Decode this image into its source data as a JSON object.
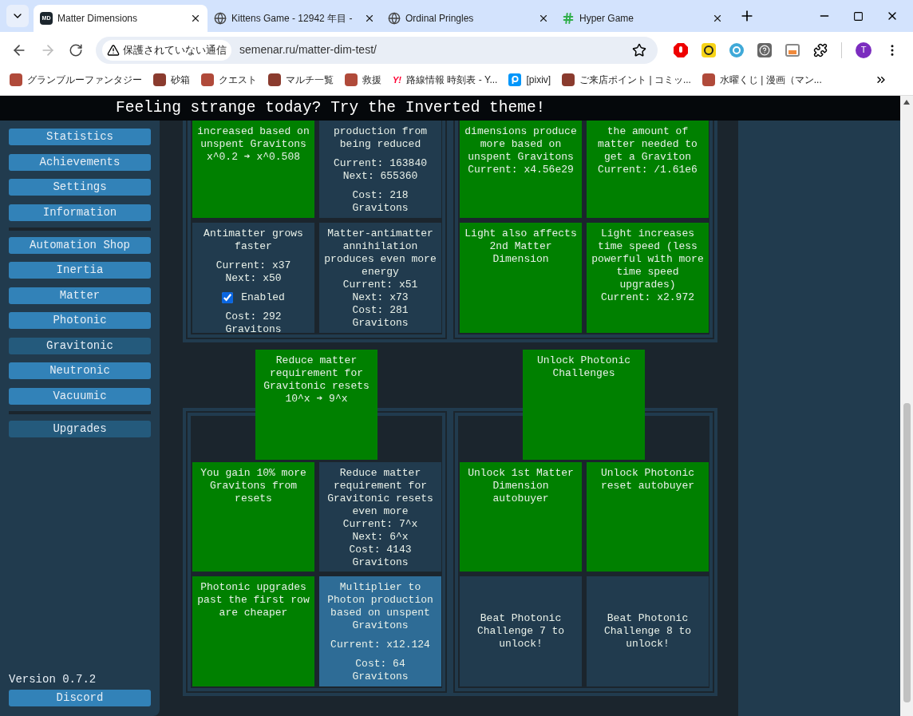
{
  "browser": {
    "tabs": [
      {
        "title": "Matter Dimensions",
        "favicon_text": "MD",
        "selected": true
      },
      {
        "title": "Kittens Game - 12942 年目 -",
        "selected": false
      },
      {
        "title": "Ordinal Pringles",
        "selected": false
      },
      {
        "title": "Hyper Game",
        "selected": false
      }
    ],
    "address": {
      "security": "保護されていない通信",
      "url": "semenar.ru/matter-dim-test/"
    },
    "profile_initial": "T",
    "bookmarks": [
      {
        "label": "グランブルーファンタジー"
      },
      {
        "label": "砂箱"
      },
      {
        "label": "クエスト"
      },
      {
        "label": "マルチ一覧"
      },
      {
        "label": "救援"
      },
      {
        "label": "路線情報 時刻表 - Y...",
        "icon_text": "Y!"
      },
      {
        "label": "[pixiv]"
      },
      {
        "label": "ご来店ポイント | コミッ..."
      },
      {
        "label": "水曜くじ | 漫画（マン..."
      }
    ]
  },
  "banner": "Feeling strange today? Try the Inverted theme!",
  "sidebar": {
    "groups": [
      {
        "items": [
          {
            "label": "Statistics",
            "selected": false
          },
          {
            "label": "Achievements",
            "selected": false
          },
          {
            "label": "Settings",
            "selected": false
          },
          {
            "label": "Information",
            "selected": false
          }
        ]
      },
      {
        "items": [
          {
            "label": "Automation Shop",
            "selected": false
          },
          {
            "label": "Inertia",
            "selected": false
          },
          {
            "label": "Matter",
            "selected": false
          },
          {
            "label": "Photonic",
            "selected": false
          },
          {
            "label": "Gravitonic",
            "selected": true
          },
          {
            "label": "Neutronic",
            "selected": false
          },
          {
            "label": "Vacuumic",
            "selected": false
          }
        ]
      },
      {
        "items": [
          {
            "label": "Upgrades",
            "selected": true
          }
        ]
      }
    ],
    "version": "Version 0.7.2",
    "discord": "Discord"
  },
  "columns": [
    {
      "top_cards": [
        {
          "kind": "bought",
          "description": "increased based on unspent Gravitons",
          "effect": [
            "x^0.2 ➔ x^0.508"
          ]
        },
        {
          "kind": "unaffordable",
          "description": "production from being reduced",
          "effect": [
            "Current: 163840",
            "Next: 655360"
          ],
          "cost": "Cost: 218 Gravitons",
          "spaced": true
        },
        {
          "kind": "unaffordable",
          "description": "Antimatter grows faster",
          "effect": [
            "Current: x37",
            "Next: x50"
          ],
          "toggle": {
            "label": "Enabled",
            "checked": true
          },
          "cost": "Cost: 292 Gravitons",
          "spaced": true
        },
        {
          "kind": "unaffordable",
          "description": "Matter-antimatter annihilation produces even more energy",
          "effect": [
            "Current: x51",
            "Next: x73"
          ],
          "cost": "Cost: 281 Gravitons",
          "spaced": false
        }
      ],
      "feature_card": {
        "kind": "bought",
        "description": "Reduce matter requirement for Gravitonic resets",
        "effect": [
          "10^x ➔ 9^x"
        ]
      },
      "bottom_cards": [
        {
          "kind": "bought",
          "description": "You gain 10% more Gravitons from resets"
        },
        {
          "kind": "unaffordable",
          "description": "Reduce matter requirement for Gravitonic resets even more",
          "effect": [
            "Current: 7^x",
            "Next: 6^x"
          ],
          "cost": "Cost: 4143 Gravitons",
          "spaced": false
        },
        {
          "kind": "bought",
          "description": "Photonic upgrades past the first row are cheaper"
        },
        {
          "kind": "affordable",
          "description": "Multiplier to Photon production based on unspent Gravitons",
          "effect": [
            "Current: x12.124"
          ],
          "cost": "Cost: 64 Gravitons",
          "spaced": true
        }
      ]
    },
    {
      "top_cards": [
        {
          "kind": "bought",
          "description": "dimensions produce more based on unspent Gravitons",
          "effect": [
            "Current: x4.56e29"
          ]
        },
        {
          "kind": "bought",
          "description": "the amount of matter needed to get a Graviton",
          "effect": [
            "Current: /1.61e6"
          ]
        },
        {
          "kind": "bought",
          "description": "Light also affects 2nd Matter Dimension"
        },
        {
          "kind": "bought",
          "description": "Light increases time speed (less powerful with more time speed upgrades)",
          "effect": [
            "Current: x2.972"
          ]
        }
      ],
      "feature_card": {
        "kind": "bought",
        "description": "Unlock Photonic Challenges"
      },
      "bottom_cards": [
        {
          "kind": "bought",
          "description": "Unlock 1st Matter Dimension autobuyer"
        },
        {
          "kind": "bought",
          "description": "Unlock Photonic reset autobuyer"
        },
        {
          "kind": "locked",
          "description": "Beat Photonic Challenge 7 to unlock!"
        },
        {
          "kind": "locked",
          "description": "Beat Photonic Challenge 8 to unlock!"
        }
      ]
    }
  ]
}
